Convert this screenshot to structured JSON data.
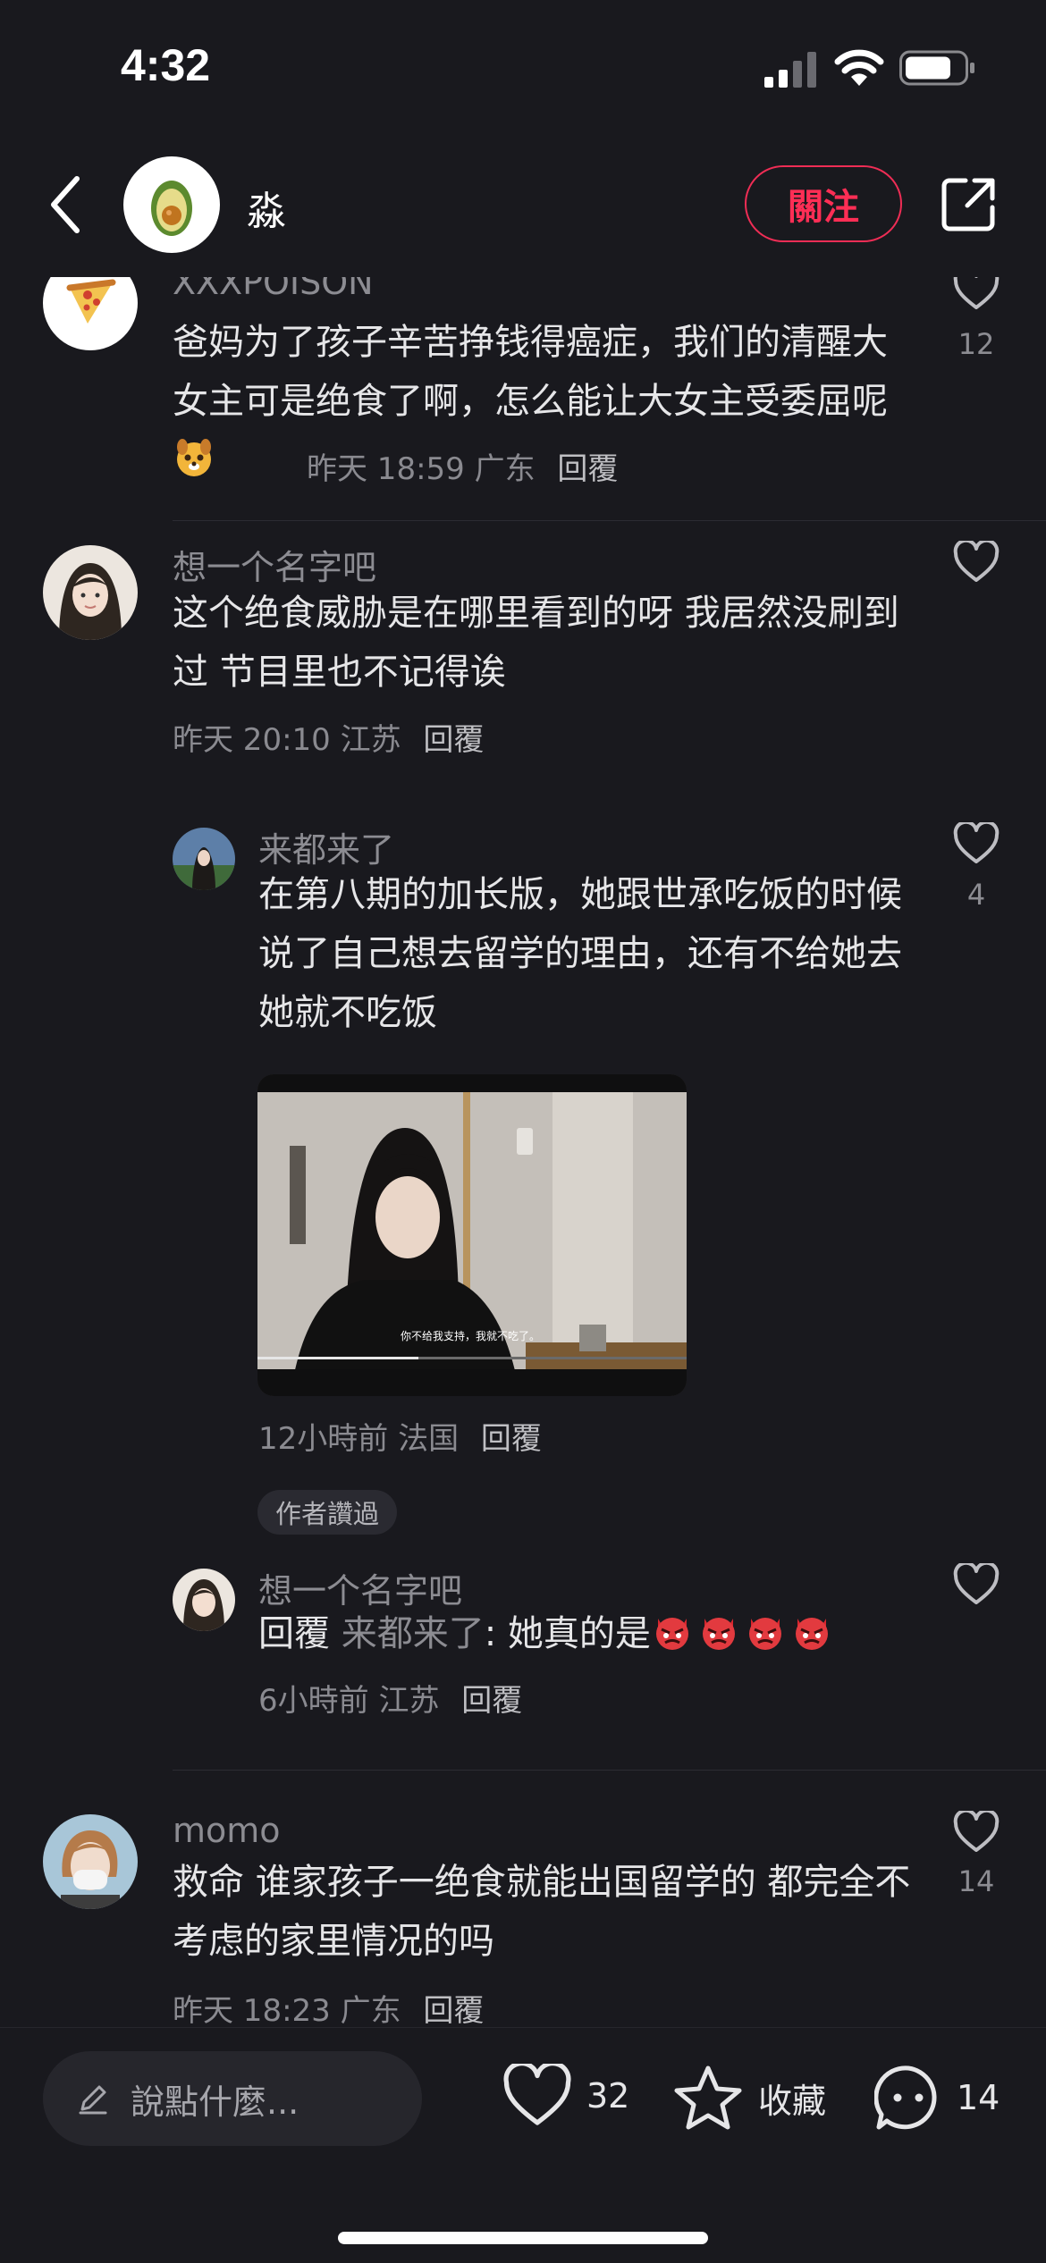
{
  "status": {
    "time": "4:32"
  },
  "header": {
    "username": "淼",
    "follow_label": "關注"
  },
  "comments": [
    {
      "name": "XXXPOISON",
      "text": "爸妈为了孩子辛苦挣钱得癌症，我们的清醒大女主可是绝食了啊，怎么能让大女主受委屈呢",
      "time": "昨天 18:59",
      "location": "广东",
      "reply_label": "回覆",
      "likes": "12"
    },
    {
      "name": "想一个名字吧",
      "text": "这个绝食威胁是在哪里看到的呀 我居然没刷到过 节目里也不记得诶",
      "time": "昨天 20:10",
      "location": "江苏",
      "reply_label": "回覆",
      "likes": ""
    },
    {
      "name": "来都来了",
      "text": "在第八期的加长版，她跟世承吃饭的时候说了自己想去留学的理由，还有不给她去她就不吃饭",
      "image_caption": "你不给我支持，我就不吃了。",
      "time": "12小時前",
      "location": "法国",
      "reply_label": "回覆",
      "badge": "作者讚過",
      "likes": "4"
    },
    {
      "name": "想一个名字吧",
      "reply_prefix": "回覆",
      "reply_to": "来都来了",
      "text": ": 她真的是",
      "time": "6小時前",
      "location": "江苏",
      "reply_label": "回覆",
      "likes": ""
    },
    {
      "name": "momo",
      "text": "救命 谁家孩子一绝食就能出国留学的 都完全不考虑的家里情况的吗",
      "time": "昨天 18:23",
      "location": "广东",
      "reply_label": "回覆",
      "likes": "14"
    }
  ],
  "bottom_bar": {
    "input_placeholder": "說點什麼...",
    "likes": "32",
    "collect_label": "收藏",
    "comments": "14"
  },
  "colors": {
    "background": "#19191e",
    "accent": "#ff2e55",
    "text": "#e6e6e8",
    "muted": "#8c8c92"
  },
  "icons": [
    "back-icon",
    "share-icon",
    "heart-icon",
    "star-icon",
    "comment-icon",
    "pencil-icon"
  ]
}
